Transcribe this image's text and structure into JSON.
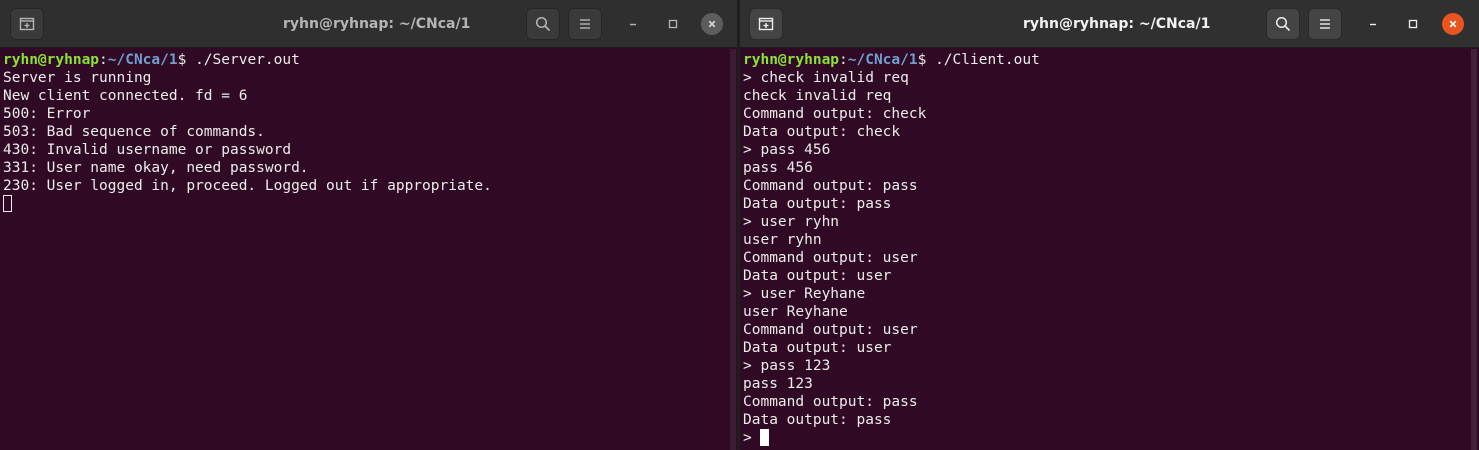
{
  "left_window": {
    "title": "ryhn@ryhnap: ~/CNca/1",
    "prompt": {
      "user_host": "ryhn@ryhnap",
      "colon": ":",
      "path": "~/CNca/1",
      "dollar": "$",
      "command": " ./Server.out"
    },
    "output": [
      "Server is running",
      "New client connected. fd = 6",
      "500: Error",
      "503: Bad sequence of commands.",
      "430: Invalid username or password",
      "331: User name okay, need password.",
      "230: User logged in, proceed. Logged out if appropriate."
    ],
    "icons": {
      "new_tab": "new-tab-icon",
      "search": "search-icon",
      "menu": "hamburger-menu-icon",
      "minimize": "minimize-icon",
      "maximize": "maximize-icon",
      "close": "close-icon"
    }
  },
  "right_window": {
    "title": "ryhn@ryhnap: ~/CNca/1",
    "prompt": {
      "user_host": "ryhn@ryhnap",
      "colon": ":",
      "path": "~/CNca/1",
      "dollar": "$",
      "command": " ./Client.out"
    },
    "output": [
      "> check invalid req",
      "check invalid req",
      "Command output: check",
      "Data output: check",
      "> pass 456",
      "pass 456",
      "Command output: pass",
      "Data output: pass",
      "> user ryhn",
      "user ryhn",
      "Command output: user",
      "Data output: user",
      "> user Reyhane",
      "user Reyhane",
      "Command output: user",
      "Data output: user",
      "> pass 123",
      "pass 123",
      "Command output: pass",
      "Data output: pass"
    ],
    "input_prompt": "> ",
    "icons": {
      "new_tab": "new-tab-icon",
      "search": "search-icon",
      "menu": "hamburger-menu-icon",
      "minimize": "minimize-icon",
      "maximize": "maximize-icon",
      "close": "close-icon"
    }
  },
  "colors": {
    "terminal_bg": "#300a24",
    "titlebar_bg": "#303030",
    "prompt_user": "#8ae234",
    "prompt_path": "#729fcf",
    "text": "#ececec",
    "close_active": "#e95420"
  }
}
